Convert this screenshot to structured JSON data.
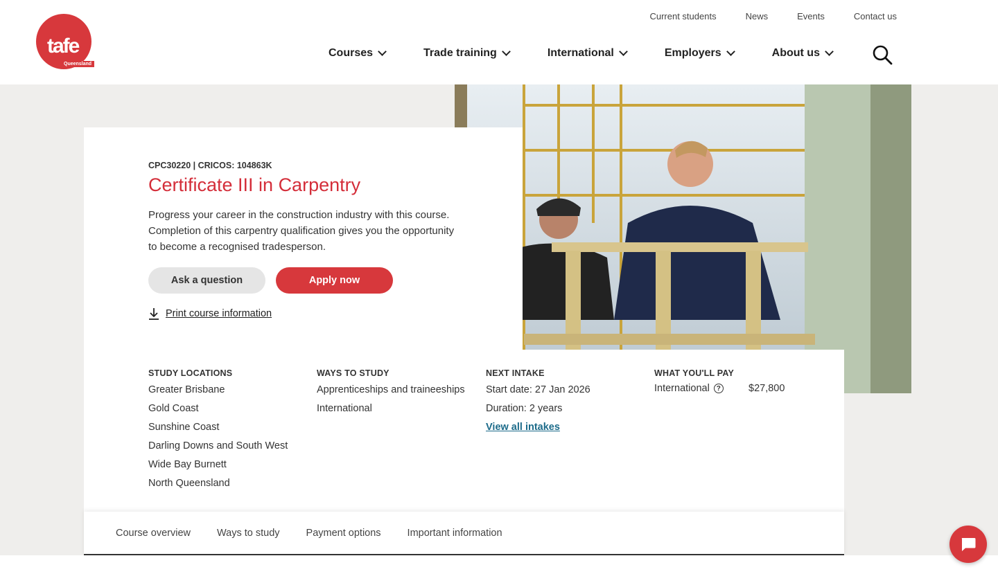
{
  "brand": {
    "logo_text": "tafe",
    "logo_sub": "Queensland",
    "accent": "#d7383c",
    "link_color": "#1c6b8a"
  },
  "utility_nav": [
    "Current students",
    "News",
    "Events",
    "Contact us"
  ],
  "main_nav": [
    "Courses",
    "Trade training",
    "International",
    "Employers",
    "About us"
  ],
  "course": {
    "code": "CPC30220 | CRICOS: 104863K",
    "title": "Certificate III in Carpentry",
    "description": "Progress your career in the construction industry with this course. Completion of this carpentry qualification gives you the opportunity to become a recognised tradesperson.",
    "ask_label": "Ask a question",
    "apply_label": "Apply now",
    "print_label": "Print course information"
  },
  "details": {
    "locations_heading": "STUDY LOCATIONS",
    "locations": [
      "Greater Brisbane",
      "Gold Coast",
      "Sunshine Coast",
      "Darling Downs and South West",
      "Wide Bay Burnett",
      "North Queensland"
    ],
    "ways_heading": "WAYS TO STUDY",
    "ways": [
      "Apprenticeships and traineeships",
      "International"
    ],
    "intake_heading": "NEXT INTAKE",
    "start_date": "Start date: 27 Jan 2026",
    "duration": "Duration: 2 years",
    "view_intakes": "View all intakes",
    "pay_heading": "WHAT YOU'LL PAY",
    "pay_type": "International",
    "pay_amount": "$27,800"
  },
  "tabs": [
    "Course overview",
    "Ways to study",
    "Payment options",
    "Important information"
  ]
}
